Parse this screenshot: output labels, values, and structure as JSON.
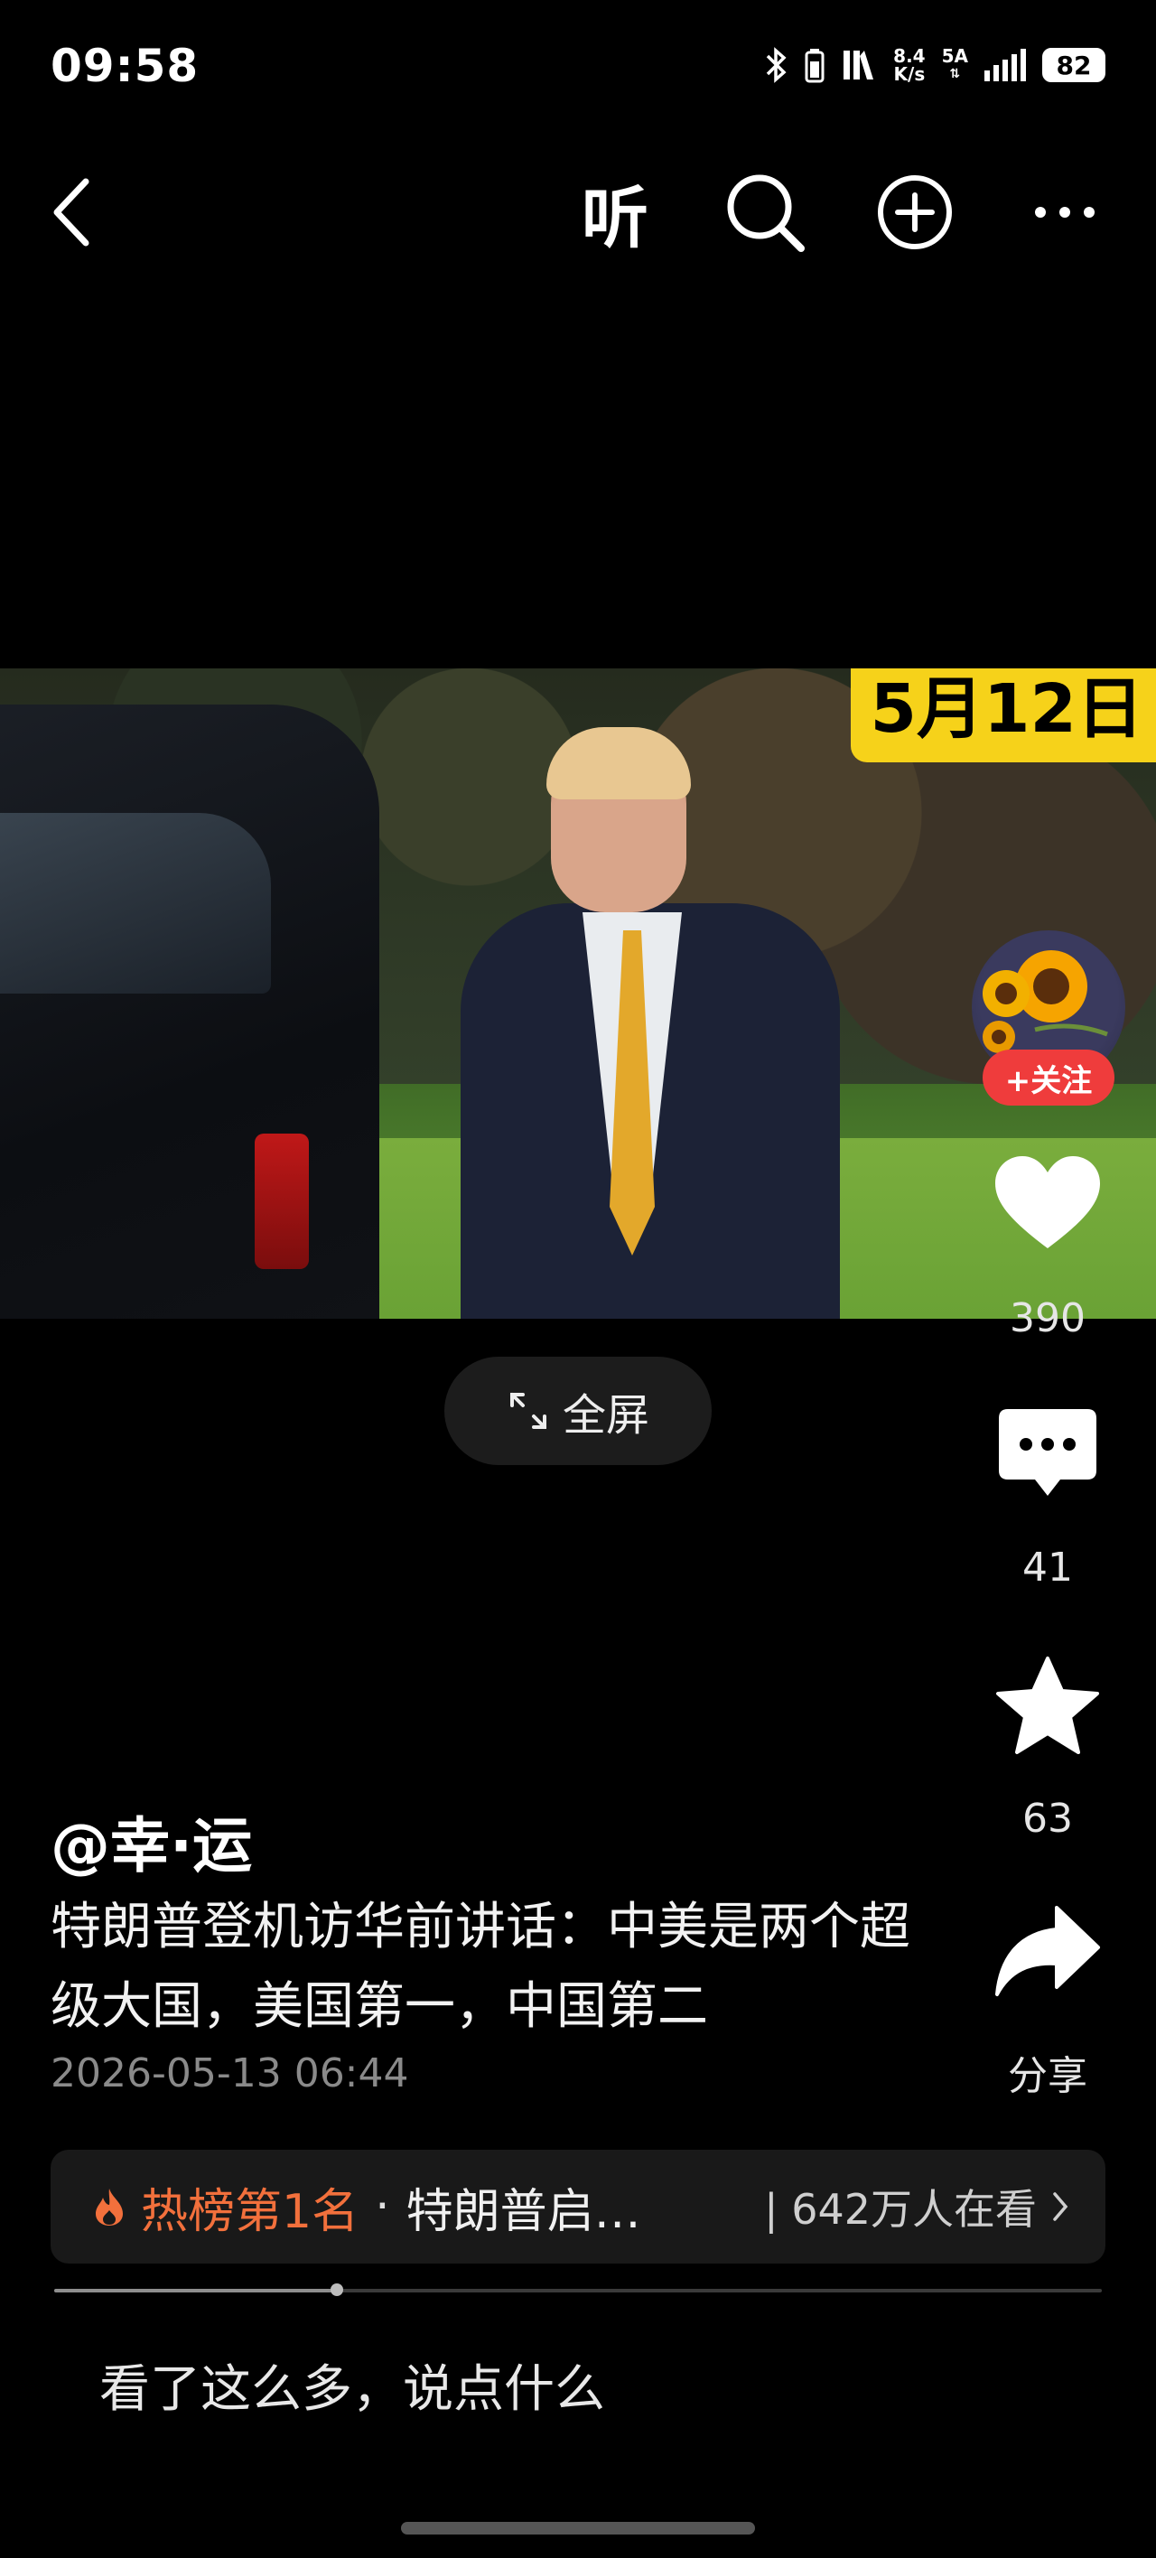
{
  "status_bar": {
    "time": "09:58",
    "net_speed_value": "8.4",
    "net_speed_unit": "K/s",
    "network_type": "5A",
    "battery": "82"
  },
  "top_nav": {
    "listen_label": "听"
  },
  "video": {
    "date_tag": "5月12日",
    "fullscreen_label": "全屏",
    "progress_fraction": 0.27
  },
  "actions": {
    "follow_label": "+关注",
    "like_count": "390",
    "comment_count": "41",
    "favorite_count": "63",
    "share_label": "分享"
  },
  "post": {
    "author": "@幸·运",
    "caption": "特朗普登机访华前讲话：中美是两个超级大国，美国第一，中国第二",
    "timestamp": "2026-05-13 06:44"
  },
  "hot_board": {
    "rank": "热榜第1名",
    "separator": "·",
    "title": "特朗普启…",
    "viewers": "| 642万人在看"
  },
  "comment_box": {
    "placeholder": "看了这么多，说点什么"
  },
  "colors": {
    "accent_red": "#ef3c3c",
    "hot_orange": "#f2703c",
    "date_tag_yellow": "#f6d21a"
  }
}
